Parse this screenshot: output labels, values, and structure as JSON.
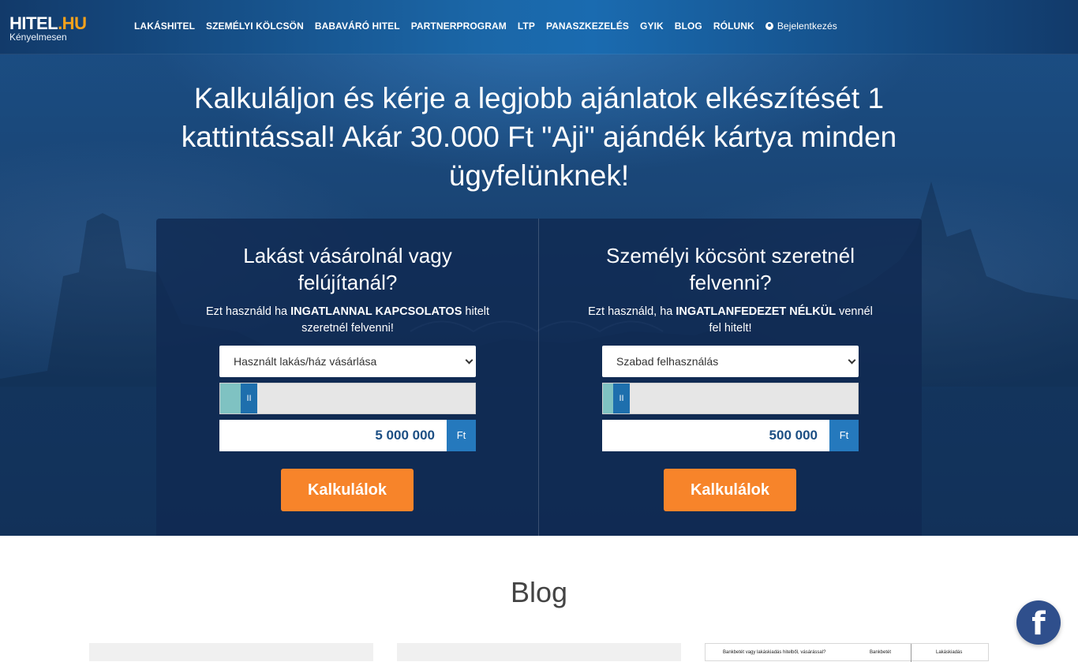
{
  "logo": {
    "main": "HITEL",
    "tld": ".HU",
    "tagline": "Kényelmesen"
  },
  "nav": {
    "items": [
      "LAKÁSHITEL",
      "SZEMÉLYI KÖLCSÖN",
      "BABAVÁRÓ HITEL",
      "PARTNERPROGRAM",
      "LTP",
      "PANASZKEZELÉS",
      "GYIK",
      "BLOG",
      "RÓLUNK"
    ],
    "login": "Bejelentkezés"
  },
  "hero": {
    "headline": "Kalkuláljon és kérje a legjobb ajánlatok elkészítését 1 kattintással! Akár 30.000 Ft \"Aji\" ajándék kártya minden ügyfelünknek!"
  },
  "calculators": [
    {
      "title": "Lakást vásárolnál vagy felújítanál?",
      "desc_pre": "Ezt használd ha ",
      "desc_bold": "INGATLANNAL KAPCSOLATOS",
      "desc_post": " hitelt szeretnél felvenni!",
      "select_value": "Használt lakás/ház vásárlása",
      "slider_fraction": 0.08,
      "slider_handle": "II",
      "amount": "5 000 000",
      "currency": "Ft",
      "button": "Kalkulálok"
    },
    {
      "title": "Személyi köcsönt szeretnél felvenni?",
      "desc_pre": "Ezt használd, ha ",
      "desc_bold": "INGATLANFEDEZET NÉLKÜL",
      "desc_post": " vennél fel hitelt!",
      "select_value": "Szabad felhasználás",
      "slider_fraction": 0.04,
      "slider_handle": "II",
      "amount": "500 000",
      "currency": "Ft",
      "button": "Kalkulálok"
    }
  ],
  "blog": {
    "title": "Blog",
    "card3_cells": [
      "Bankbetét vagy lakáskiadás hitelből, vásárással?",
      "Bankbetét",
      "Lakáskiadás"
    ]
  },
  "social": {
    "facebook_glyph": "f"
  },
  "colors": {
    "accent_orange": "#f7842a",
    "brand_blue": "#2579bd",
    "logo_tld": "#f7a21b"
  }
}
